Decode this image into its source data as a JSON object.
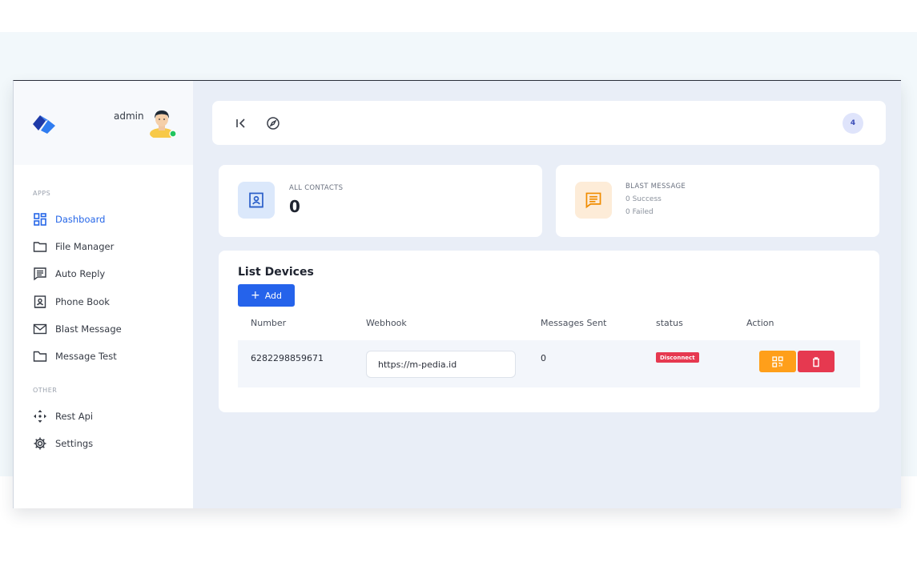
{
  "user": {
    "name": "admin"
  },
  "sidebar": {
    "sections": [
      {
        "label": "APPS"
      },
      {
        "label": "OTHER"
      }
    ],
    "items": [
      {
        "label": "Dashboard",
        "icon": "dashboard-icon",
        "active": true
      },
      {
        "label": "File Manager",
        "icon": "folder-icon"
      },
      {
        "label": "Auto Reply",
        "icon": "message-square-icon"
      },
      {
        "label": "Phone Book",
        "icon": "contact-book-icon"
      },
      {
        "label": "Blast Message",
        "icon": "mail-icon"
      },
      {
        "label": "Message Test",
        "icon": "file-folder-icon"
      },
      {
        "label": "Rest Api",
        "icon": "api-move-icon"
      },
      {
        "label": "Settings",
        "icon": "gear-icon"
      }
    ]
  },
  "topbar": {
    "notification_count": "4"
  },
  "stats": {
    "contacts": {
      "label": "ALL CONTACTS",
      "value": "0"
    },
    "blast": {
      "label": "BLAST MESSAGE",
      "success": "0 Success",
      "failed": "0 Failed"
    }
  },
  "devices": {
    "title": "List Devices",
    "add_label": "Add",
    "columns": [
      "Number",
      "Webhook",
      "Messages Sent",
      "status",
      "Action"
    ],
    "rows": [
      {
        "number": "6282298859671",
        "webhook": "https://m-pedia.id",
        "messages_sent": "0",
        "status": "Disconnect"
      }
    ]
  },
  "colors": {
    "primary": "#2563eb",
    "warning": "#ff9f1a",
    "danger": "#e63950",
    "online": "#22c55e"
  }
}
